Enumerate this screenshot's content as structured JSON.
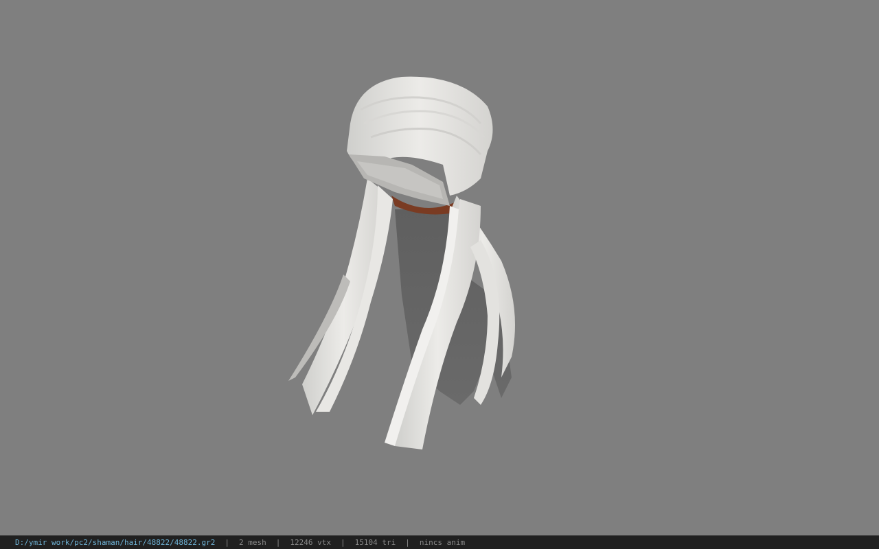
{
  "viewport": {
    "background_color": "#7f7f7f",
    "model_icon": "hair-mesh-icon"
  },
  "status": {
    "path": "D:/ymir work/pc2/shaman/hair/48822/48822.gr2",
    "separator": "|",
    "mesh": "2 mesh",
    "vtx": "12246 vtx",
    "tri": "15104 tri",
    "anim": "nincs anim",
    "path_color": "#6fb3d6",
    "text_color": "#8a8a8a"
  }
}
